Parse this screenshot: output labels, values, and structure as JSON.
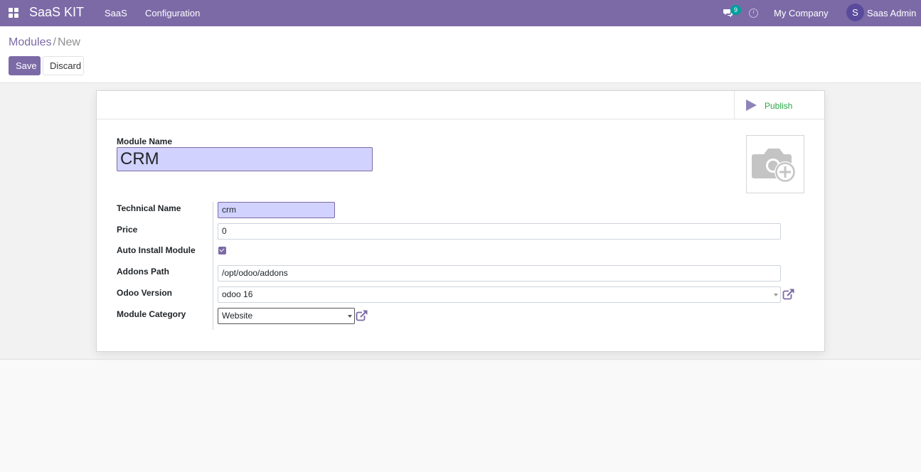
{
  "navbar": {
    "brand": "SaaS KIT",
    "menus": [
      "SaaS",
      "Configuration"
    ],
    "messages_badge": "9",
    "company": "My Company",
    "avatar_initial": "S",
    "user": "Saas Admin"
  },
  "breadcrumb": {
    "parent": "Modules",
    "separator": "/",
    "current": "New"
  },
  "actions": {
    "save": "Save",
    "discard": "Discard"
  },
  "sheet": {
    "publish_label": "Publish",
    "module_name_label": "Module Name",
    "module_name_value": "CRM",
    "fields": {
      "technical_name": {
        "label": "Technical Name",
        "value": "crm"
      },
      "price": {
        "label": "Price",
        "value": "0"
      },
      "auto_install": {
        "label": "Auto Install Module",
        "checked": true
      },
      "addons_path": {
        "label": "Addons Path",
        "value": "/opt/odoo/addons"
      },
      "odoo_version": {
        "label": "Odoo Version",
        "value": "odoo 16"
      },
      "module_category": {
        "label": "Module Category",
        "value": "Website"
      }
    }
  },
  "icons": {
    "apps": "apps-grid-icon",
    "messages": "chat-icon",
    "activity": "clock-icon",
    "publish": "play-icon",
    "image": "camera-plus-icon",
    "external": "external-link-icon"
  },
  "colors": {
    "primary": "#7c6aa7",
    "required_field": "#d2d2ff",
    "publish_text": "#28a745",
    "badge": "#00a09d"
  }
}
